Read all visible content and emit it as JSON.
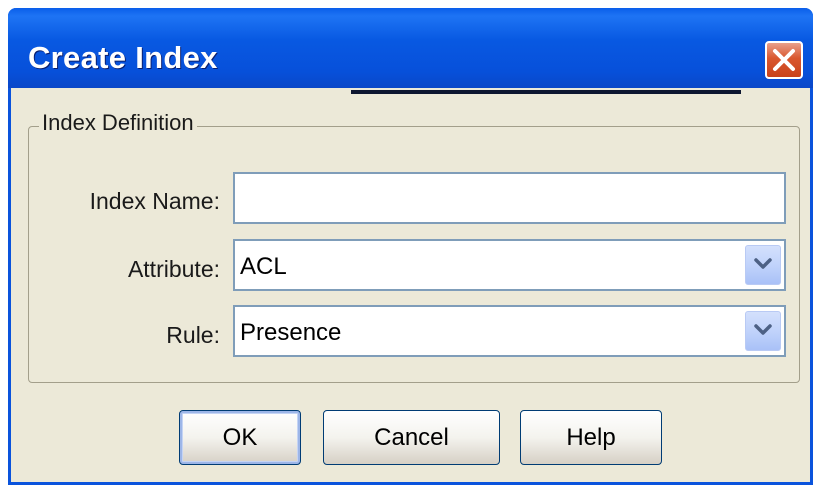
{
  "window": {
    "title": "Create Index"
  },
  "group": {
    "legend": "Index Definition"
  },
  "form": {
    "index_name": {
      "label": "Index Name:",
      "value": ""
    },
    "attribute": {
      "label": "Attribute:",
      "value": "ACL"
    },
    "rule": {
      "label": "Rule:",
      "value": "Presence"
    }
  },
  "buttons": {
    "ok": "OK",
    "cancel": "Cancel",
    "help": "Help"
  },
  "icons": {
    "close": "close-icon",
    "dropdown": "chevron-down-icon"
  },
  "colors": {
    "titlebar": "#0A53DC",
    "close_button": "#D9572E",
    "dialog_bg": "#ECE9D8"
  }
}
